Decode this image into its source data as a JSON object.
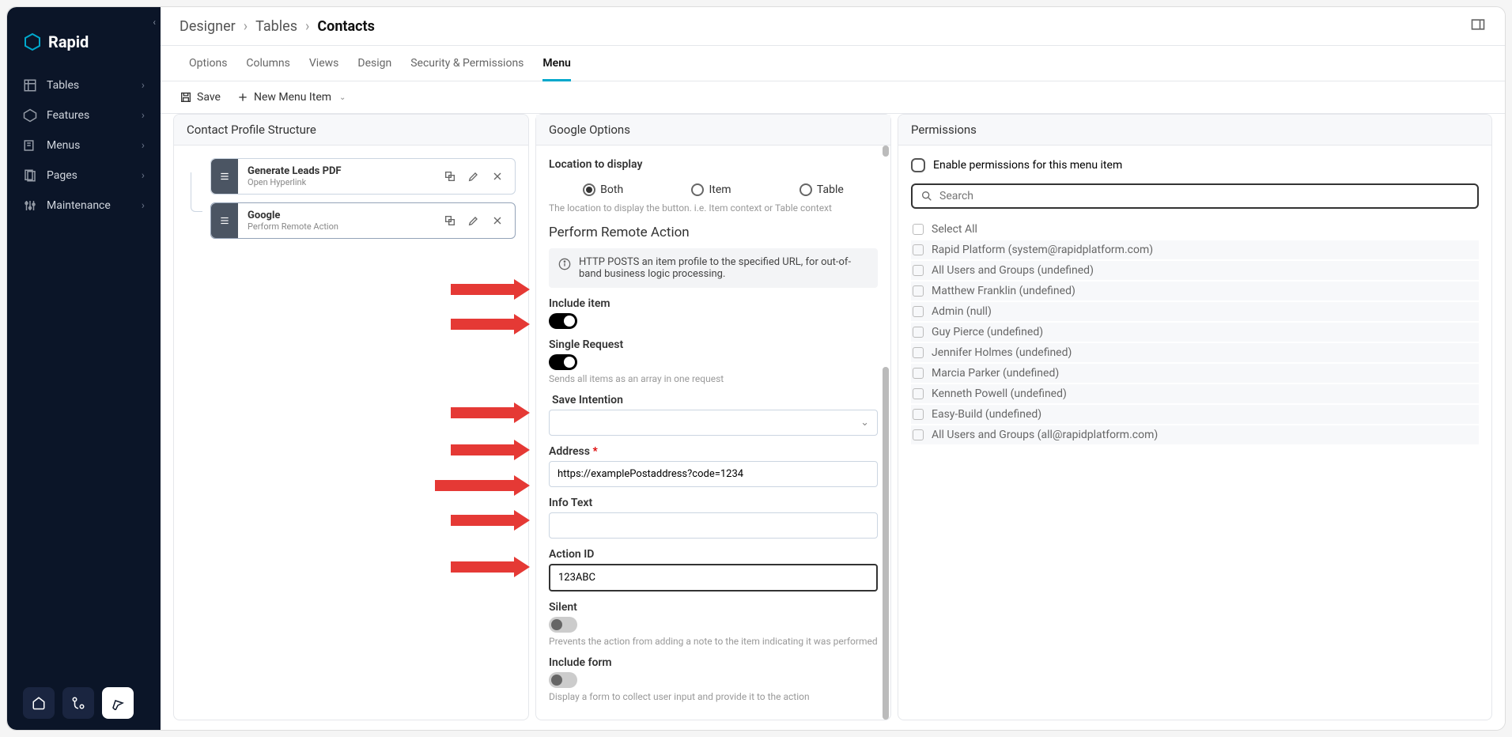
{
  "logo": {
    "text": "Rapid"
  },
  "sidebar": {
    "items": [
      {
        "label": "Tables"
      },
      {
        "label": "Features"
      },
      {
        "label": "Menus"
      },
      {
        "label": "Pages"
      },
      {
        "label": "Maintenance"
      }
    ]
  },
  "breadcrumb": {
    "items": [
      "Designer",
      "Tables",
      "Contacts"
    ]
  },
  "tabs": {
    "items": [
      "Options",
      "Columns",
      "Views",
      "Design",
      "Security & Permissions",
      "Menu"
    ],
    "active": "Menu"
  },
  "toolbar": {
    "save": "Save",
    "newMenu": "New Menu Item"
  },
  "leftPanel": {
    "title": "Contact Profile Structure",
    "items": [
      {
        "title": "Generate Leads PDF",
        "sub": "Open Hyperlink"
      },
      {
        "title": "Google",
        "sub": "Perform Remote Action"
      }
    ]
  },
  "midPanel": {
    "title": "Google Options",
    "locationLabel": "Location to display",
    "radios": [
      "Both",
      "Item",
      "Table"
    ],
    "locationHelp": "The location to display the button. i.e. Item context or Table context",
    "sectionTitle": "Perform Remote Action",
    "infoBox": "HTTP POSTS an item profile to the specified URL, for out-of-band business logic processing.",
    "includeItem": "Include item",
    "singleRequest": "Single Request",
    "singleRequestHelp": "Sends all items as an array in one request",
    "saveIntention": "Save Intention",
    "address": "Address",
    "addressValue": "https://examplePostaddress?code=1234",
    "infoText": "Info Text",
    "actionId": "Action ID",
    "actionIdValue": "123ABC",
    "silent": "Silent",
    "silentHelp": "Prevents the action from adding a note to the item indicating it was performed",
    "includeForm": "Include form",
    "includeFormHelp": "Display a form to collect user input and provide it to the action"
  },
  "rightPanel": {
    "title": "Permissions",
    "enableLabel": "Enable permissions for this menu item",
    "searchPlaceholder": "Search",
    "selectAll": "Select All",
    "items": [
      "Rapid Platform (system@rapidplatform.com)",
      "All Users and Groups (undefined)",
      "Matthew Franklin (undefined)",
      "Admin (null)",
      "Guy Pierce (undefined)",
      "Jennifer Holmes (undefined)",
      "Marcia Parker (undefined)",
      "Kenneth Powell (undefined)",
      "Easy-Build (undefined)",
      "All Users and Groups (all@rapidplatform.com)"
    ]
  }
}
